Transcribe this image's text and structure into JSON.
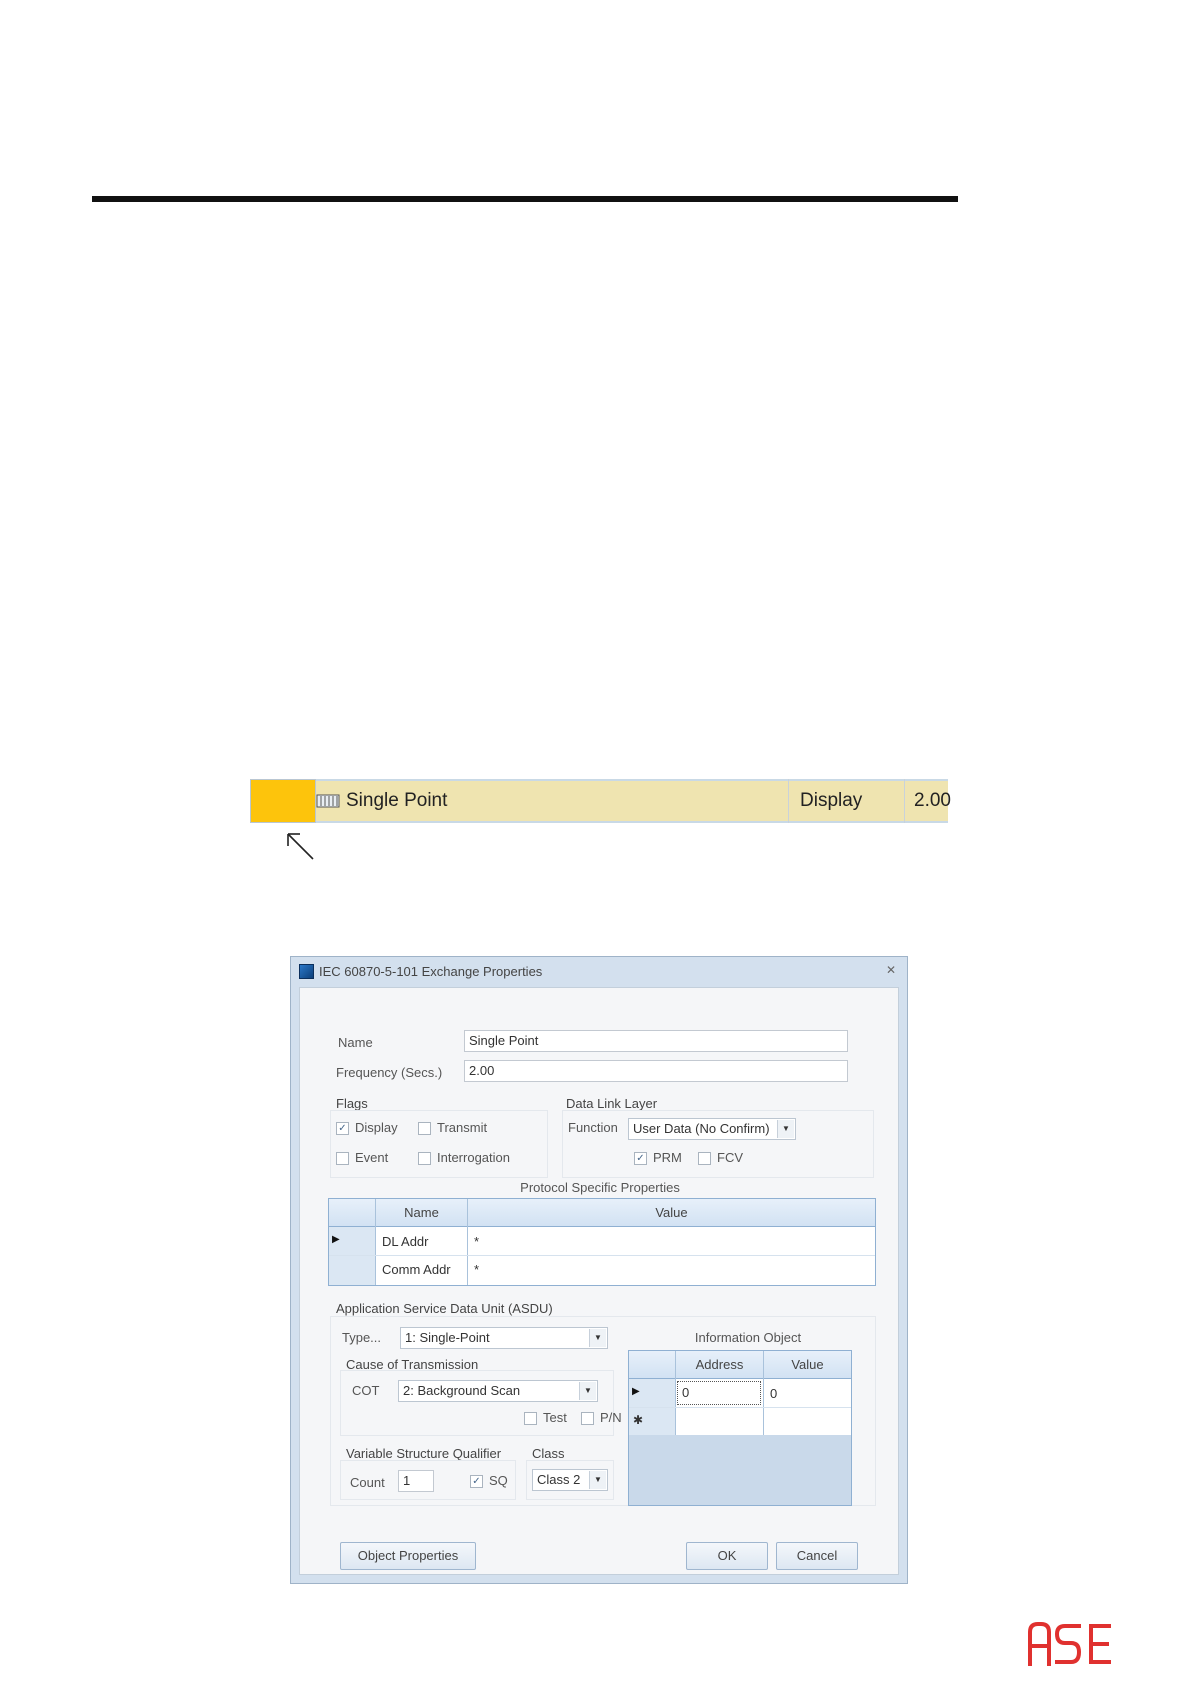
{
  "exchange_row": {
    "name": "Single Point",
    "flag": "Display",
    "frequency": "2.00",
    "icon": "single-point-icon",
    "selection_color": "#fdc40c",
    "row_color": "#efe4b0"
  },
  "dialog": {
    "title": "IEC 60870-5-101 Exchange Properties",
    "close_glyph": "✕",
    "name_label": "Name",
    "name_value": "Single Point",
    "frequency_label": "Frequency (Secs.)",
    "frequency_value": "2.00",
    "flags": {
      "title": "Flags",
      "display": {
        "label": "Display",
        "checked": true
      },
      "transmit": {
        "label": "Transmit",
        "checked": false
      },
      "event": {
        "label": "Event",
        "checked": false
      },
      "interrogation": {
        "label": "Interrogation",
        "checked": false
      }
    },
    "data_link": {
      "title": "Data Link Layer",
      "function_label": "Function",
      "function_value": "User Data (No Confirm)",
      "prm": {
        "label": "PRM",
        "checked": true
      },
      "fcv": {
        "label": "FCV",
        "checked": false
      }
    },
    "protocol": {
      "title": "Protocol Specific Properties",
      "headers": [
        "Name",
        "Value"
      ],
      "rows": [
        {
          "name": "DL Addr",
          "value": "*"
        },
        {
          "name": "Comm Addr",
          "value": "*"
        }
      ]
    },
    "asdu": {
      "title": "Application Service Data Unit (ASDU)",
      "type_label": "Type...",
      "type_value": "1: Single-Point",
      "cot_group": "Cause of Transmission",
      "cot_label": "COT",
      "cot_value": "2: Background Scan",
      "test": {
        "label": "Test",
        "checked": false
      },
      "pn": {
        "label": "P/N",
        "checked": false
      },
      "vsq_group": "Variable Structure Qualifier",
      "count_label": "Count",
      "count_value": "1",
      "sq": {
        "label": "SQ",
        "checked": true
      },
      "class_group": "Class",
      "class_value": "Class 2",
      "info_object": {
        "title": "Information Object",
        "headers": [
          "Address",
          "Value"
        ],
        "rows": [
          {
            "address": "0",
            "value": "0"
          }
        ],
        "new_row_glyph": "✱"
      }
    },
    "buttons": {
      "object_properties": "Object Properties",
      "ok": "OK",
      "cancel": "Cancel"
    }
  },
  "logo": {
    "text": "ASE",
    "color": "#e0312f"
  }
}
